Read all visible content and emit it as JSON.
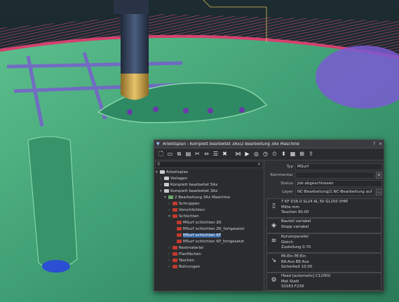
{
  "colors": {
    "panel_bg": "#2f3032",
    "selection": "#3b6aa6",
    "accent_red": "#c23a2e",
    "part_green": "#4aa47a",
    "toolpath_magenta": "#d63a7a",
    "toolpath_purple": "#7a5ad2",
    "tool_gold": "#c9a24a",
    "tool_steel": "#3a4a63"
  },
  "window": {
    "title": "Arbeitsplan - Komplett bearbeitet 3Ax/2 Bearbeitung 3Ax Maschine",
    "help_label": "?",
    "close_label": "×"
  },
  "toolbar": {
    "icons": [
      "new-document-icon",
      "open-folder-icon",
      "copy-icon",
      "paste-icon",
      "scissors-icon",
      "move-icon",
      "list-icon",
      "delete-icon",
      "cut-icon",
      "play-icon",
      "simulate-icon",
      "stopwatch-icon",
      "timer-icon",
      "tool-icon",
      "calc-icon",
      "machine-icon",
      "export-icon"
    ]
  },
  "tree": {
    "search_icon": "magnifier",
    "clear_label": "×",
    "items": [
      {
        "label": "Arbeitsplan",
        "level": 0
      },
      {
        "label": "Vorlagen",
        "level": 1
      },
      {
        "label": "Komplett bearbeitet 5Ax",
        "level": 1
      },
      {
        "label": "Komplett bearbeitet 3Ax",
        "level": 1
      },
      {
        "label": "2 Bearbeitung 3Ax Maschine",
        "level": 2
      },
      {
        "label": "Schruppen",
        "level": 3
      },
      {
        "label": "Vorschlichten",
        "level": 3
      },
      {
        "label": "Schlichten",
        "level": 3
      },
      {
        "label": "MSurf   schlichten ZK",
        "level": 4
      },
      {
        "label": "MSurf   schlichten ZK_fortgesetzt",
        "level": 4
      },
      {
        "label": "MSurf   schlichten KP",
        "level": 4,
        "selected": true
      },
      {
        "label": "MSurf   schlichten KP_fortgesetzt",
        "level": 4
      },
      {
        "label": "Restmaterial",
        "level": 3
      },
      {
        "label": "Planflächen",
        "level": 3
      },
      {
        "label": "Taschen",
        "level": 3
      },
      {
        "label": "Bohrungen",
        "level": 3
      }
    ]
  },
  "properties": {
    "typ_label": "Typ",
    "typ_value": "MSurf",
    "kommentar_label": "Kommentar",
    "kommentar_value": "",
    "status_label": "Status",
    "status_value": "Job abgeschlossen",
    "layer_label": "Layer",
    "layer_value": "NC-Bearbeitung/2.NC-Bearbeitung auf"
  },
  "cards": [
    {
      "icon": "tool-icon",
      "lines": [
        "T KF D16.0 SL24  AL 50 GL150 VHM",
        "Mitte mm",
        "Tauchen 90.00"
      ]
    },
    {
      "icon": "part-icon",
      "lines": [
        "Bauteil variabel",
        "Stopp variabel"
      ]
    },
    {
      "icon": "strategy-icon",
      "lines": [
        "Kurvenparallel",
        "Gleich",
        "Zustellung 0.70"
      ]
    },
    {
      "icon": "approach-icon",
      "lines": [
        "PA:Ein PE:Ein",
        "BA:Aus BE:Aus",
        "Sicherheit 10.00"
      ]
    },
    {
      "icon": "machine-head-icon",
      "lines": [
        "Head [automatic] C1200U",
        "Mat Stahl",
        "S3183 F239"
      ]
    }
  ]
}
